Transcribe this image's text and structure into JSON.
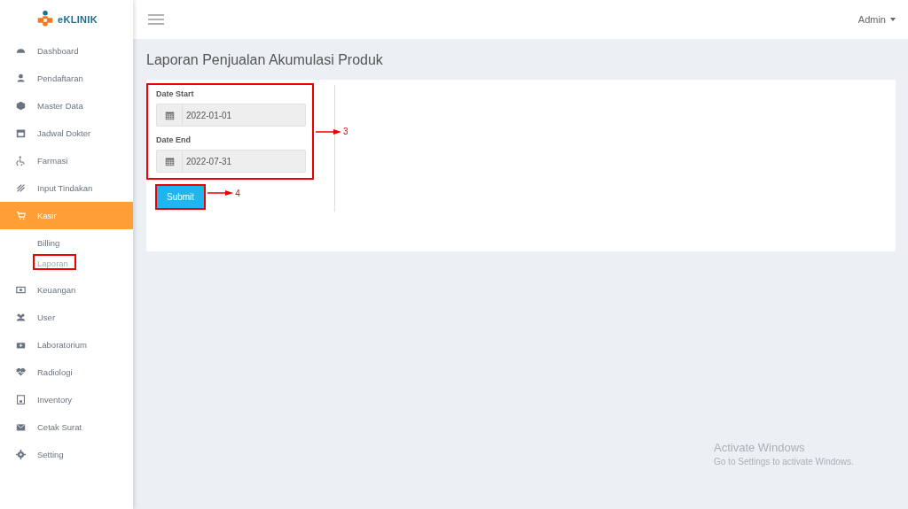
{
  "brand": {
    "name": "eKLINIK"
  },
  "sidebar": {
    "items": [
      {
        "label": "Dashboard",
        "selected": false
      },
      {
        "label": "Pendaftaran",
        "selected": false
      },
      {
        "label": "Master Data",
        "selected": false
      },
      {
        "label": "Jadwal Dokter",
        "selected": false
      },
      {
        "label": "Farmasi",
        "selected": false
      },
      {
        "label": "Input Tindakan",
        "selected": false
      },
      {
        "label": "Kasir",
        "selected": true,
        "children": [
          {
            "label": "Billing",
            "selected": false,
            "highlighted": false
          },
          {
            "label": "Laporan",
            "selected": true,
            "highlighted": true
          }
        ]
      },
      {
        "label": "Keuangan",
        "selected": false
      },
      {
        "label": "User",
        "selected": false
      },
      {
        "label": "Laboratorium",
        "selected": false
      },
      {
        "label": "Radiologi",
        "selected": false
      },
      {
        "label": "Inventory",
        "selected": false
      },
      {
        "label": "Cetak Surat",
        "selected": false
      },
      {
        "label": "Setting",
        "selected": false
      }
    ]
  },
  "header": {
    "user": "Admin"
  },
  "page": {
    "title": "Laporan Penjualan Akumulasi Produk"
  },
  "form": {
    "highlighted": true,
    "callout": "3",
    "fields": [
      {
        "label": "Date Start",
        "value": "2022-01-01"
      },
      {
        "label": "Date End",
        "value": "2022-07-31"
      }
    ],
    "submit": {
      "label": "Submit",
      "highlighted": true,
      "callout": "4"
    }
  },
  "os_notice": {
    "title": "Activate Windows",
    "text": "Go to Settings to activate Windows."
  }
}
